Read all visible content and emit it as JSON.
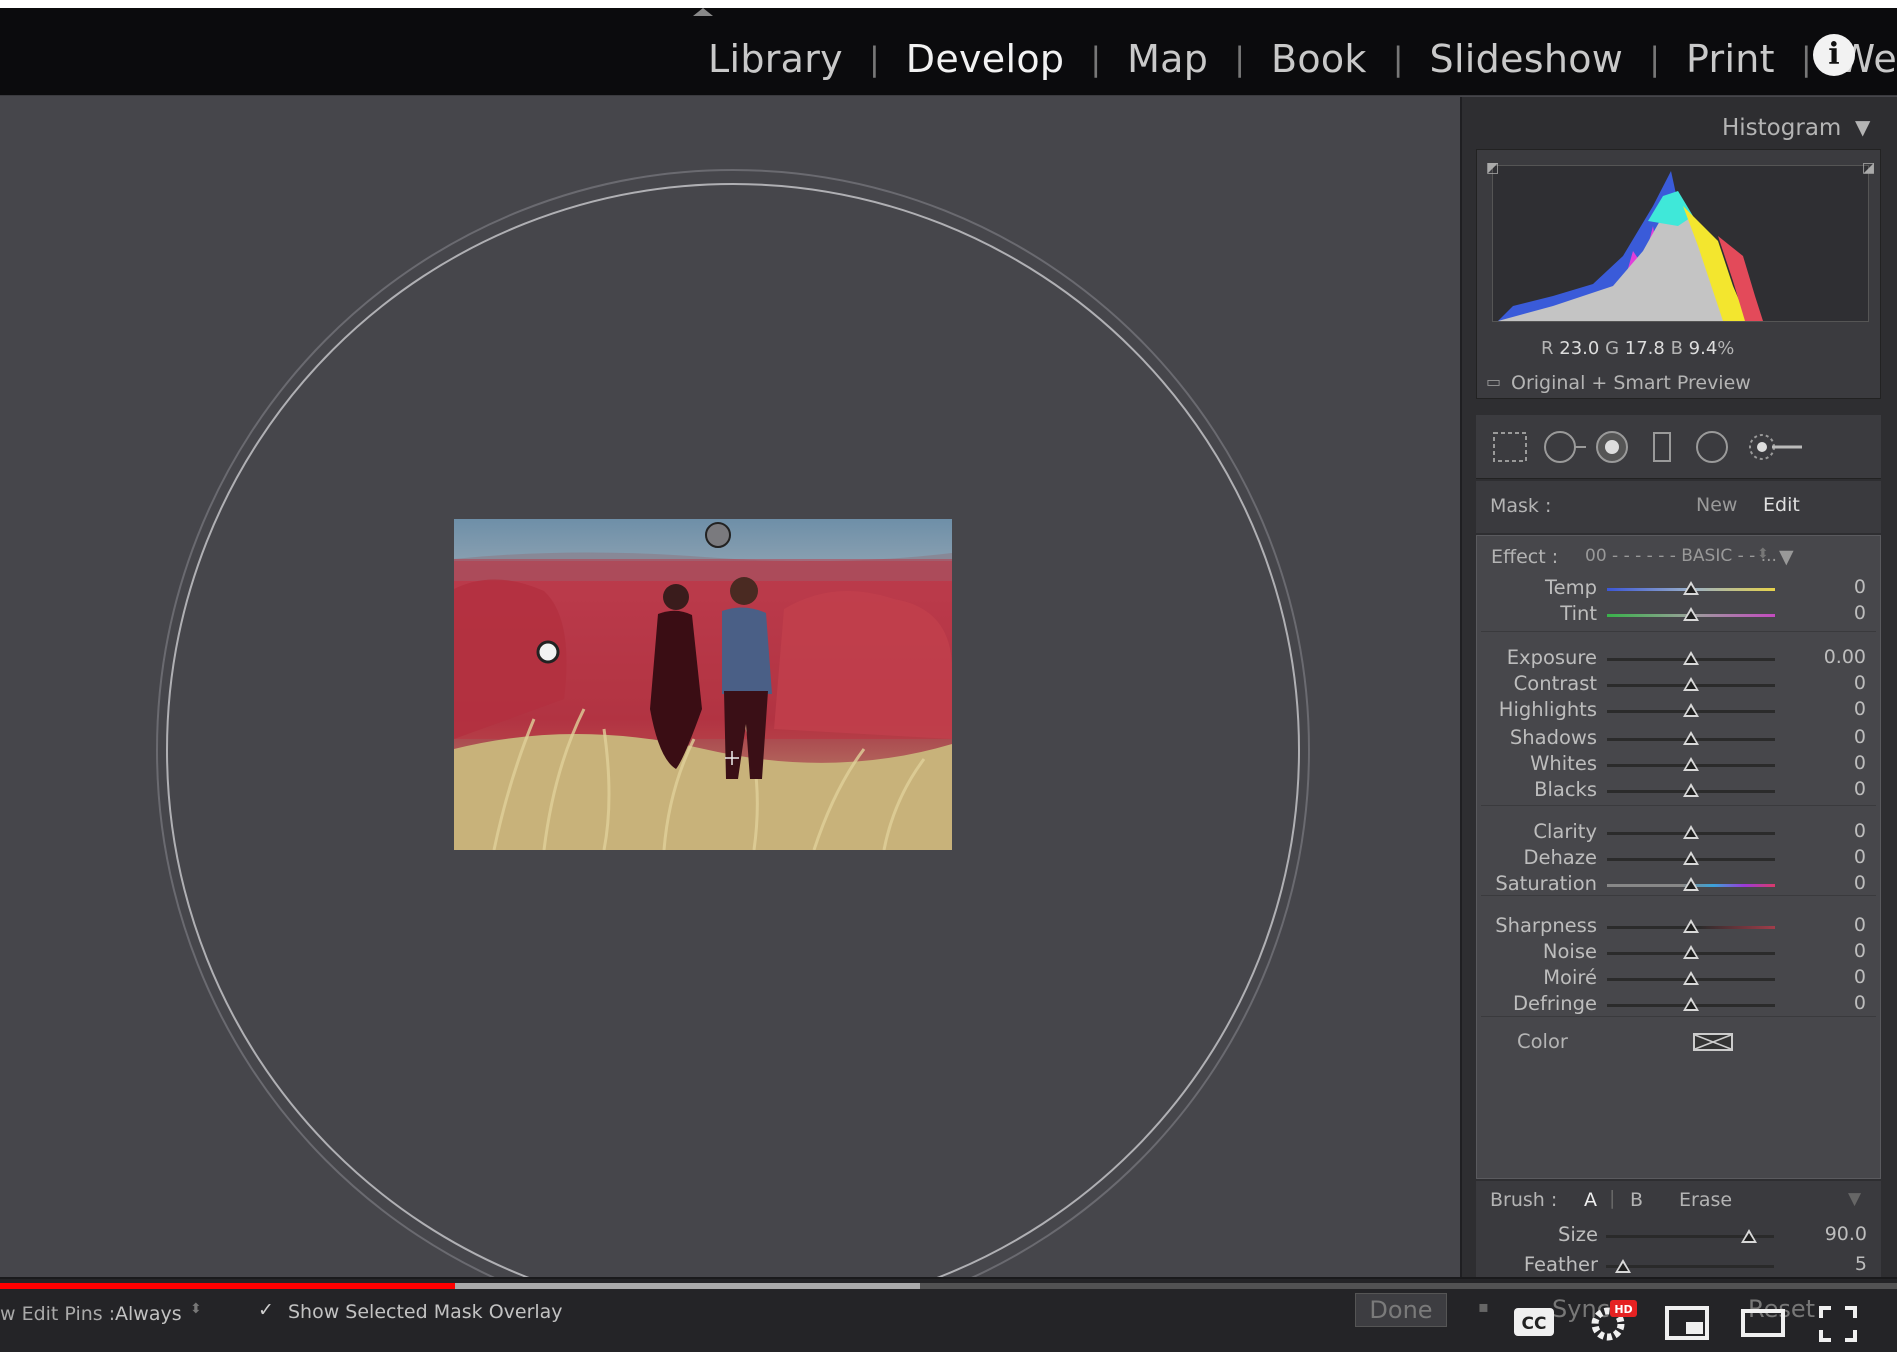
{
  "modules": {
    "items": [
      {
        "label": "Library",
        "active": false
      },
      {
        "label": "Develop",
        "active": true
      },
      {
        "label": "Map",
        "active": false
      },
      {
        "label": "Book",
        "active": false
      },
      {
        "label": "Slideshow",
        "active": false
      },
      {
        "label": "Print",
        "active": false
      },
      {
        "label": "We",
        "active": false
      }
    ],
    "info_glyph": "i"
  },
  "histogram": {
    "title": "Histogram",
    "readout": {
      "r_label": "R",
      "r_value": "23.0",
      "g_label": "G",
      "g_value": "17.8",
      "b_label": "B",
      "b_value": "9.4",
      "unit": "%"
    },
    "preview_label": "Original + Smart Preview"
  },
  "mask": {
    "label": "Mask :",
    "new_label": "New",
    "edit_label": "Edit"
  },
  "effect": {
    "label": "Effect :",
    "preset": "00 - - - - - - BASIC - - ..."
  },
  "sliders": [
    {
      "label": "Temp",
      "value": "0",
      "position": 0.5,
      "track": "temp"
    },
    {
      "label": "Tint",
      "value": "0",
      "position": 0.5,
      "track": "tint"
    },
    {
      "label": "Exposure",
      "value": "0.00",
      "position": 0.5,
      "track": "plain"
    },
    {
      "label": "Contrast",
      "value": "0",
      "position": 0.5,
      "track": "plain"
    },
    {
      "label": "Highlights",
      "value": "0",
      "position": 0.5,
      "track": "plain"
    },
    {
      "label": "Shadows",
      "value": "0",
      "position": 0.5,
      "track": "plain"
    },
    {
      "label": "Whites",
      "value": "0",
      "position": 0.5,
      "track": "plain"
    },
    {
      "label": "Blacks",
      "value": "0",
      "position": 0.5,
      "track": "plain"
    },
    {
      "label": "Clarity",
      "value": "0",
      "position": 0.5,
      "track": "plain"
    },
    {
      "label": "Dehaze",
      "value": "0",
      "position": 0.5,
      "track": "plain"
    },
    {
      "label": "Saturation",
      "value": "0",
      "position": 0.5,
      "track": "saturation"
    },
    {
      "label": "Sharpness",
      "value": "0",
      "position": 0.5,
      "track": "sharpness"
    },
    {
      "label": "Noise",
      "value": "0",
      "position": 0.5,
      "track": "plain"
    },
    {
      "label": "Moiré",
      "value": "0",
      "position": 0.5,
      "track": "plain"
    },
    {
      "label": "Defringe",
      "value": "0",
      "position": 0.5,
      "track": "plain"
    }
  ],
  "color_row": {
    "label": "Color"
  },
  "brush": {
    "label": "Brush :",
    "a_label": "A",
    "b_label": "B",
    "erase_label": "Erase",
    "size_label": "Size",
    "size_value": "90.0",
    "size_position": 0.85,
    "feather_label": "Feather",
    "feather_value": "5",
    "feather_position": 0.1
  },
  "toolbar": {
    "edit_pins_label": "w Edit Pins :",
    "edit_pins_value": "Always",
    "overlay_check": "✓",
    "overlay_label": "Show Selected Mask Overlay",
    "done_label": "Done",
    "sync_label": "Sync...",
    "reset_label": "Reset"
  },
  "player": {
    "played_fraction": 0.24,
    "buffered_fraction": 0.485,
    "cc_label": "CC",
    "hd_label": "HD"
  },
  "colors": {
    "panel_bg": "#2e2e31",
    "canvas_bg": "#46464b",
    "mask_overlay": "#c0303a",
    "progress_red": "#ff0000"
  },
  "icons": [
    "info-icon",
    "histogram-toggle-icon",
    "crop-icon",
    "spot-removal-icon",
    "red-eye-icon",
    "graduated-filter-icon",
    "radial-filter-icon",
    "adjustment-brush-icon",
    "cc-icon",
    "settings-gear-icon",
    "miniplayer-icon",
    "theater-mode-icon",
    "fullscreen-icon"
  ]
}
